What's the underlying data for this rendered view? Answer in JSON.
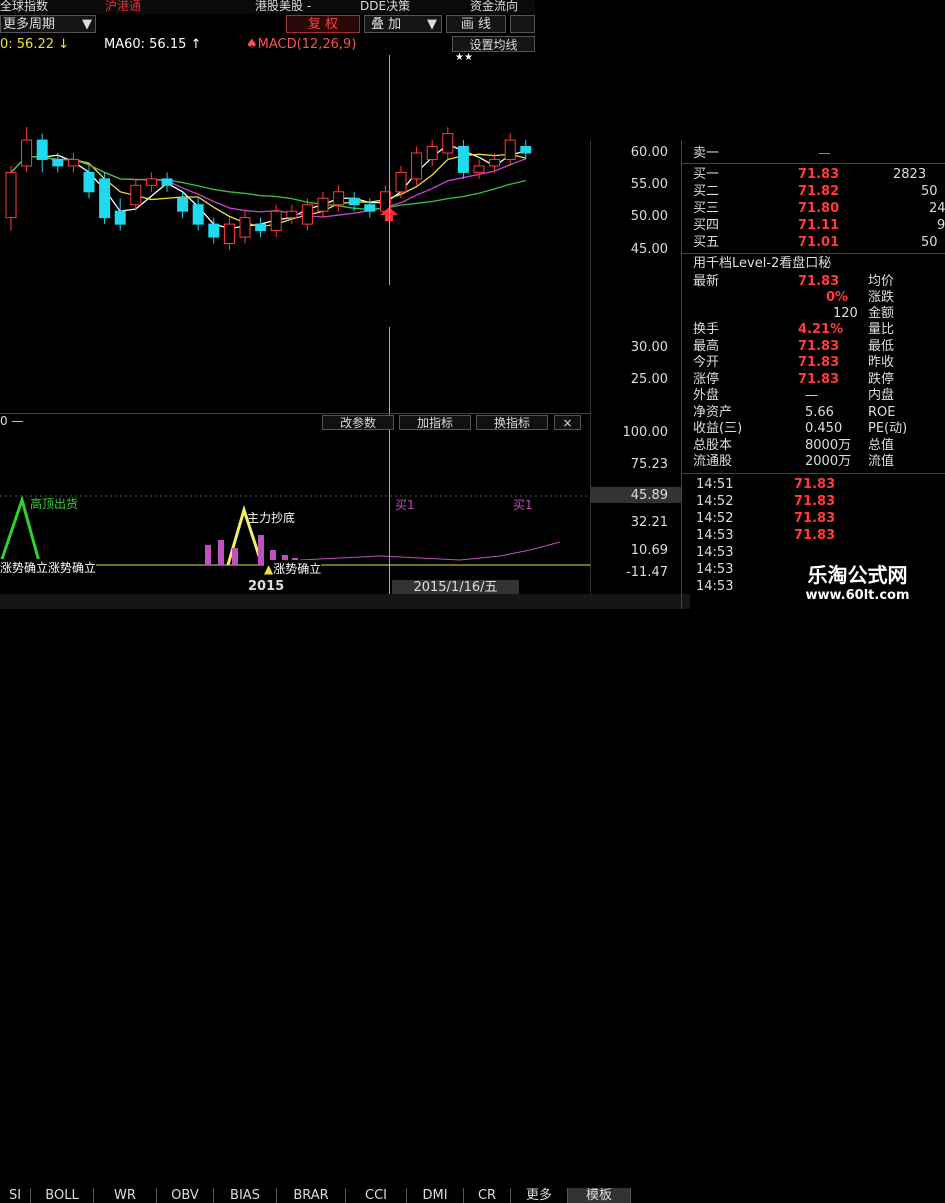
{
  "menu": [
    {
      "label": "全球指数",
      "active": false
    },
    {
      "label": "沪港通",
      "active": true
    },
    {
      "label": "港股美股 -",
      "active": false
    },
    {
      "label": "DDE决策",
      "active": false
    },
    {
      "label": "资金流向",
      "active": false
    }
  ],
  "toolbar": {
    "period": "更多周期",
    "fuquan": "复 权",
    "diejia": "叠 加",
    "huaxian": "画 线"
  },
  "ma_labels": {
    "ma30": "0: 56.22 ↓",
    "ma60": "MA60: 56.15 ↑",
    "macd": "MACD(12,26,9)",
    "set_ma": "设置均线",
    "stars": "★★"
  },
  "price_axis": [
    "60.00",
    "55.00",
    "50.00",
    "45.00",
    "30.00",
    "25.00"
  ],
  "indicator": {
    "header": "0 —",
    "buttons": [
      "改参数",
      "加指标",
      "换指标"
    ],
    "close": "×",
    "axis": [
      "100.00",
      "75.23",
      "45.89",
      "32.21",
      "10.69",
      "-11.47"
    ],
    "labels": {
      "high_sell": "高顶出货",
      "bottom": "主力抄底",
      "trend1": "涨势确立",
      "trend2": "涨势确立",
      "buy1": "买1",
      "buy2": "买1"
    }
  },
  "bottom": {
    "year": "2015",
    "date": "2015/1/16/五",
    "tabs": [
      "SI",
      "BOLL",
      "WR",
      "OBV",
      "BIAS",
      "BRAR",
      "CCI",
      "DMI",
      "CR",
      "更多",
      "模板"
    ]
  },
  "orderbook": {
    "sell1": {
      "label": "卖一",
      "price": "—",
      "vol": ""
    },
    "buys": [
      {
        "label": "买一",
        "price": "71.83",
        "vol": "2823"
      },
      {
        "label": "买二",
        "price": "71.82",
        "vol": "50"
      },
      {
        "label": "买三",
        "price": "71.80",
        "vol": "24"
      },
      {
        "label": "买四",
        "price": "71.11",
        "vol": "9"
      },
      {
        "label": "买五",
        "price": "71.01",
        "vol": "50"
      }
    ],
    "level2": "用千档Level-2看盘口秘"
  },
  "quote": {
    "latest": {
      "label": "最新",
      "value": "71.83",
      "l2": "均价"
    },
    "change": {
      "value": "0%",
      "l2": "涨跌"
    },
    "amount": {
      "value": "120",
      "l2": "金额"
    },
    "rows": [
      {
        "label": "换手",
        "value": "4.21%",
        "l2": "量比"
      },
      {
        "label": "最高",
        "value": "71.83",
        "l2": "最低"
      },
      {
        "label": "今开",
        "value": "71.83",
        "l2": "昨收"
      },
      {
        "label": "涨停",
        "value": "71.83",
        "l2": "跌停"
      },
      {
        "label": "外盘",
        "value": "—",
        "l2": "内盘"
      },
      {
        "label": "净资产",
        "value": "5.66",
        "l2": "ROE"
      },
      {
        "label": "收益(三)",
        "value": "0.450",
        "l2": "PE(动)"
      },
      {
        "label": "总股本",
        "value": "8000万",
        "l2": "总值"
      },
      {
        "label": "流通股",
        "value": "2000万",
        "l2": "流值"
      }
    ]
  },
  "ticks": [
    {
      "time": "14:51",
      "price": "71.83"
    },
    {
      "time": "14:52",
      "price": "71.83"
    },
    {
      "time": "14:52",
      "price": "71.83"
    },
    {
      "time": "14:53",
      "price": "71.83"
    },
    {
      "time": "14:53",
      "price": ""
    },
    {
      "time": "14:53",
      "price": ""
    },
    {
      "time": "14:53",
      "price": ""
    }
  ],
  "watermark": {
    "title": "乐淘公式网",
    "url": "www.60lt.com"
  },
  "colors": {
    "up": "#ff3b3b",
    "down": "#20d8f0",
    "ma5": "#ffffff",
    "ma10": "#e8e040",
    "ma20": "#d040d0",
    "ma60": "#40c040"
  },
  "candles": [
    {
      "o": 50,
      "c": 57,
      "h": 58,
      "l": 48
    },
    {
      "o": 58,
      "c": 62,
      "h": 64,
      "l": 57
    },
    {
      "o": 62,
      "c": 59,
      "h": 63,
      "l": 57
    },
    {
      "o": 59,
      "c": 58,
      "h": 60,
      "l": 57
    },
    {
      "o": 58,
      "c": 59,
      "h": 60,
      "l": 57
    },
    {
      "o": 57,
      "c": 54,
      "h": 58,
      "l": 53
    },
    {
      "o": 56,
      "c": 50,
      "h": 57,
      "l": 49
    },
    {
      "o": 51,
      "c": 49,
      "h": 53,
      "l": 48
    },
    {
      "o": 52,
      "c": 55,
      "h": 56,
      "l": 51
    },
    {
      "o": 55,
      "c": 56,
      "h": 57,
      "l": 54
    },
    {
      "o": 56,
      "c": 55,
      "h": 57,
      "l": 54
    },
    {
      "o": 53,
      "c": 51,
      "h": 54,
      "l": 50
    },
    {
      "o": 52,
      "c": 49,
      "h": 53,
      "l": 48
    },
    {
      "o": 49,
      "c": 47,
      "h": 50,
      "l": 46
    },
    {
      "o": 46,
      "c": 49,
      "h": 50,
      "l": 45
    },
    {
      "o": 47,
      "c": 50,
      "h": 51,
      "l": 46
    },
    {
      "o": 49,
      "c": 48,
      "h": 50,
      "l": 47
    },
    {
      "o": 48,
      "c": 51,
      "h": 52,
      "l": 47
    },
    {
      "o": 50,
      "c": 51,
      "h": 52,
      "l": 49
    },
    {
      "o": 49,
      "c": 52,
      "h": 53,
      "l": 48
    },
    {
      "o": 51,
      "c": 53,
      "h": 54,
      "l": 50
    },
    {
      "o": 52,
      "c": 54,
      "h": 55,
      "l": 51
    },
    {
      "o": 53,
      "c": 52,
      "h": 54,
      "l": 51
    },
    {
      "o": 52,
      "c": 51,
      "h": 53,
      "l": 50
    },
    {
      "o": 51,
      "c": 54,
      "h": 55,
      "l": 50
    },
    {
      "o": 54,
      "c": 57,
      "h": 58,
      "l": 53
    },
    {
      "o": 56,
      "c": 60,
      "h": 61,
      "l": 55
    },
    {
      "o": 59,
      "c": 61,
      "h": 62,
      "l": 58
    },
    {
      "o": 60,
      "c": 63,
      "h": 64,
      "l": 59
    },
    {
      "o": 61,
      "c": 57,
      "h": 62,
      "l": 56
    },
    {
      "o": 57,
      "c": 58,
      "h": 59,
      "l": 56
    },
    {
      "o": 58,
      "c": 59,
      "h": 60,
      "l": 57
    },
    {
      "o": 59,
      "c": 62,
      "h": 63,
      "l": 58
    },
    {
      "o": 61,
      "c": 60,
      "h": 62,
      "l": 59
    }
  ]
}
